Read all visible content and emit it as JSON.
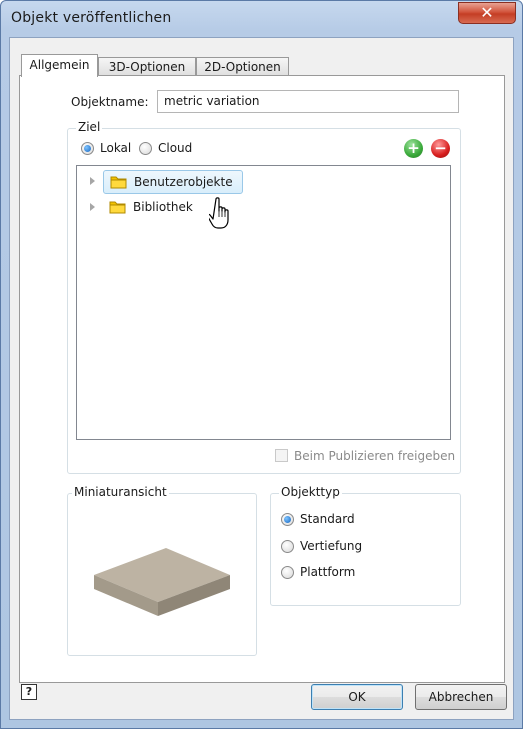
{
  "window": {
    "title": "Objekt veröffentlichen",
    "close_glyph": "✕"
  },
  "tabs": [
    {
      "label": "Allgemein",
      "active": true
    },
    {
      "label": "3D-Optionen",
      "active": false
    },
    {
      "label": "2D-Optionen",
      "active": false
    }
  ],
  "object_name": {
    "label": "Objektname:",
    "value": "metric variation"
  },
  "target": {
    "title": "Ziel",
    "options": [
      {
        "label": "Lokal",
        "checked": true
      },
      {
        "label": "Cloud",
        "checked": false
      }
    ],
    "add_glyph": "+",
    "remove_glyph": "−",
    "tree": [
      {
        "label": "Benutzerobjekte",
        "selected": true
      },
      {
        "label": "Bibliothek",
        "selected": false
      }
    ],
    "share_checkbox": {
      "label": "Beim Publizieren freigeben",
      "checked": false,
      "enabled": false
    }
  },
  "thumbnail": {
    "title": "Miniaturansicht"
  },
  "object_type": {
    "title": "Objekttyp",
    "options": [
      {
        "label": "Standard",
        "checked": true
      },
      {
        "label": "Vertiefung",
        "checked": false
      },
      {
        "label": "Plattform",
        "checked": false
      }
    ]
  },
  "footer": {
    "help_glyph": "?",
    "ok_label": "OK",
    "cancel_label": "Abbrechen"
  },
  "colors": {
    "add_button": "#3aa93a",
    "remove_button": "#d81e1e",
    "folder": "#f2c200",
    "tile_top": "#bdb3a3",
    "tile_side": "#8f8677"
  },
  "icons": [
    "close-icon",
    "add-icon",
    "remove-icon",
    "folder-icon",
    "hand-cursor-icon",
    "help-icon",
    "expander-icon"
  ]
}
